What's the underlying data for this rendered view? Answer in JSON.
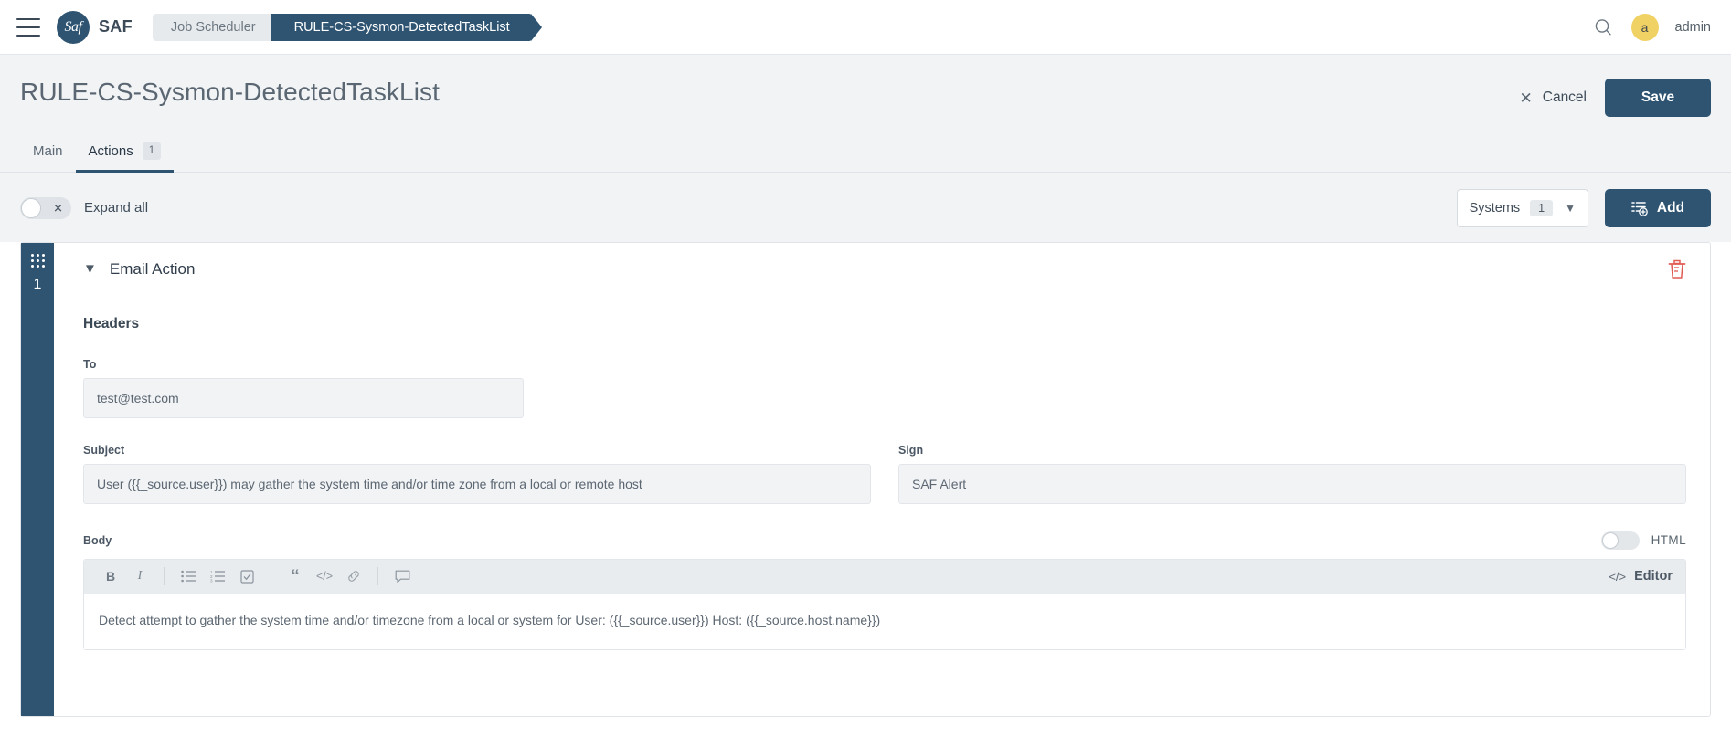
{
  "topbar": {
    "menu_icon": "hamburger-icon",
    "brand": "SAF",
    "logo_text": "Saf",
    "breadcrumbs": [
      {
        "label": "Job Scheduler",
        "active": false
      },
      {
        "label": "RULE-CS-Sysmon-DetectedTaskList",
        "active": true
      }
    ],
    "search_icon": "search-icon",
    "avatar_initial": "a",
    "username": "admin"
  },
  "pagehead": {
    "title": "RULE-CS-Sysmon-DetectedTaskList",
    "cancel_label": "Cancel",
    "cancel_icon": "close-icon",
    "save_label": "Save",
    "tabs": [
      {
        "label": "Main",
        "badge": ""
      },
      {
        "label": "Actions",
        "badge": "1"
      }
    ]
  },
  "toolrow": {
    "expand_all_label": "Expand all",
    "expand_all_state": "off",
    "expand_all_icon": "close-icon",
    "systems_label": "Systems",
    "systems_count": "1",
    "systems_chevron": "chevron-down-icon",
    "add_label": "Add",
    "add_icon": "add-list-icon"
  },
  "action_card": {
    "index": "1",
    "drag_handle_icon": "drag-dots-icon",
    "collapse_icon": "chevron-down-icon",
    "title": "Email Action",
    "delete_icon": "trash-icon",
    "section_headers": "Headers",
    "fields": {
      "to": {
        "label": "To",
        "value": "test@test.com"
      },
      "subject": {
        "label": "Subject",
        "value": "User ({{_source.user}}) may gather the system time and/or time zone from a local or remote host"
      },
      "sign": {
        "label": "Sign",
        "value": "SAF Alert"
      },
      "body": {
        "label": "Body"
      }
    },
    "html_toggle": {
      "label": "HTML",
      "state": "off"
    },
    "editor": {
      "toolbar": [
        {
          "name": "bold-icon",
          "glyph": "B"
        },
        {
          "name": "italic-icon",
          "glyph": "I"
        },
        {
          "name": "bullet-list-icon",
          "glyph": ""
        },
        {
          "name": "ordered-list-icon",
          "glyph": ""
        },
        {
          "name": "checklist-icon",
          "glyph": ""
        },
        {
          "name": "quote-icon",
          "glyph": "“"
        },
        {
          "name": "code-icon",
          "glyph": "</>"
        },
        {
          "name": "link-icon",
          "glyph": ""
        },
        {
          "name": "comment-icon",
          "glyph": ""
        }
      ],
      "mode_label": "Editor",
      "mode_icon": "code-icon",
      "content": "Detect attempt to gather the system time and/or timezone from a local or system for User: ({{_source.user}}) Host: ({{_source.host.name}})"
    }
  },
  "colors": {
    "brand_dark": "#2e5472",
    "page_bg": "#f1f3f5",
    "avatar_yellow": "#f0d264",
    "danger_red": "#e05b52"
  }
}
